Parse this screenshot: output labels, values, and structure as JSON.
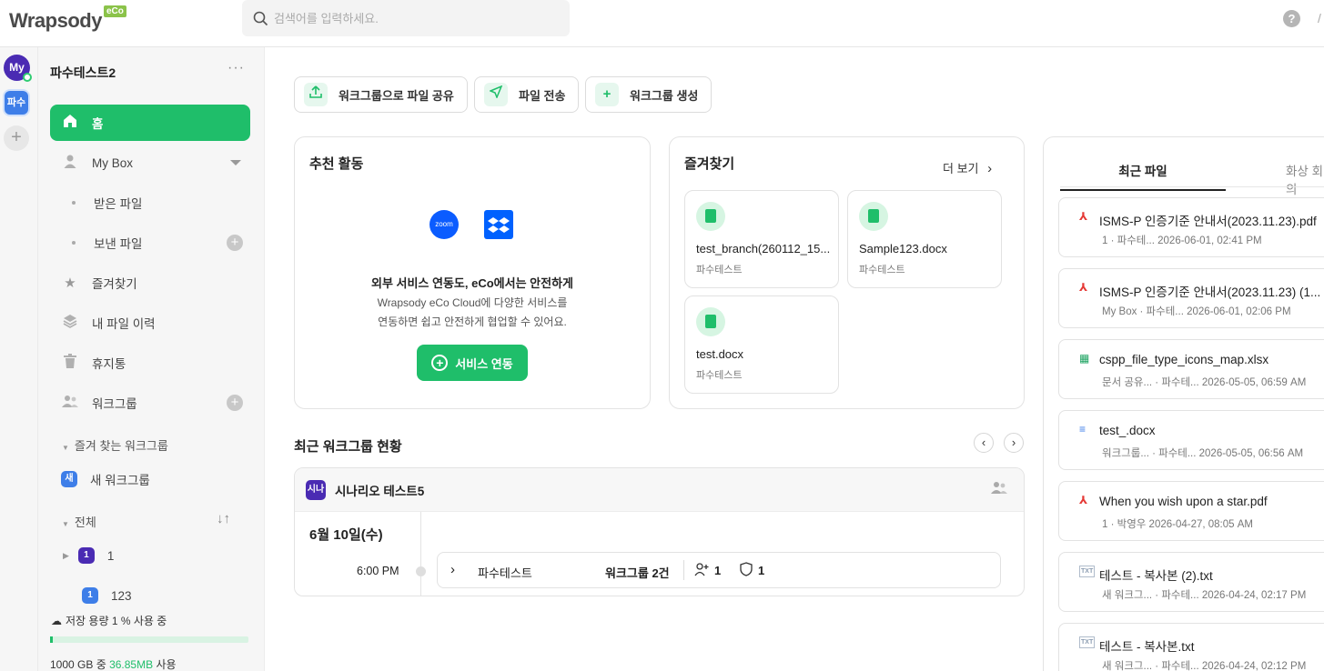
{
  "topbar": {
    "logo": "Wrapsody",
    "logo_badge": "eCo",
    "search_placeholder": "검색어를 입력하세요.",
    "help": "?",
    "user_glyph": "/"
  },
  "rail": {
    "avatar": "My",
    "workspace": "파수",
    "add": "+"
  },
  "sidebar": {
    "workspace_title": "파수테스트2",
    "more": "···",
    "items": [
      {
        "label": "홈",
        "icon": "home-icon"
      },
      {
        "label": "My Box",
        "icon": "user-icon"
      },
      {
        "label": "받은 파일"
      },
      {
        "label": "보낸 파일"
      },
      {
        "label": "즐겨찾기",
        "icon": "star-icon"
      },
      {
        "label": "내 파일 이력",
        "icon": "layers-icon"
      },
      {
        "label": "휴지통",
        "icon": "trash-icon"
      },
      {
        "label": "워크그룹",
        "icon": "group-icon"
      }
    ],
    "favorite_workgroups_label": "즐겨 찾는 워크그룹",
    "fav_workgroup": {
      "badge": "새",
      "label": "새 워크그룹"
    },
    "all_label": "전체",
    "workgroups": [
      {
        "badge": "1",
        "label": "1"
      },
      {
        "badge": "1",
        "label": "123"
      }
    ],
    "storage": {
      "label": "저장 용량 1 % 사용 중",
      "used_fraction": 0.01,
      "total": "1000 GB 중 ",
      "used": "36.85MB",
      "suffix": " 사용"
    }
  },
  "quick_actions": [
    {
      "label": "워크그룹으로 파일 공유",
      "icon": "upload-icon"
    },
    {
      "label": "파일 전송",
      "icon": "send-icon"
    },
    {
      "label": "워크그룹 생성",
      "icon": "plus-icon"
    }
  ],
  "recommend": {
    "title": "추천 활동",
    "zoom_label": "zoom",
    "headline": "외부 서비스 연동도, eCo에서는 안전하게",
    "desc_line1": "Wrapsody eCo Cloud에 다양한 서비스를",
    "desc_line2": "연동하면 쉽고 안전하게 협업할 수 있어요.",
    "button": "서비스 연동"
  },
  "favorites": {
    "title": "즐겨찾기",
    "more": "더 보기",
    "files": [
      {
        "name": "test_branch(260112_15...",
        "owner": "파수테스트"
      },
      {
        "name": "Sample123.docx",
        "owner": "파수테스트"
      },
      {
        "name": "test.docx",
        "owner": "파수테스트"
      }
    ]
  },
  "recent_workgroups": {
    "title": "최근 워크그룹 현황",
    "prev": "‹",
    "next": "›",
    "group": {
      "badge": "시나",
      "name": "시나리오 테스트5"
    },
    "date": "6월 10일(수)",
    "time": "6:00 PM",
    "row": {
      "actor": "파수테스트",
      "summary": "워크그룹 2건",
      "members": "1",
      "security": "1"
    }
  },
  "right_panel": {
    "tab_active": "최근 파일",
    "tab_inactive": "화상 회의",
    "files": [
      {
        "type": "pdf",
        "name": "ISMS-P 인증기준 안내서(2023.11.23).pdf",
        "meta": "1 · 파수테...    2026-06-01, 02:41 PM"
      },
      {
        "type": "pdf",
        "name": "ISMS-P 인증기준 안내서(2023.11.23) (1...",
        "meta": "My Box · 파수테...    2026-06-01, 02:06 PM"
      },
      {
        "type": "xlsx",
        "name": "cspp_file_type_icons_map.xlsx",
        "meta": "문서 공유... · 파수테...    2026-05-05, 06:59 AM"
      },
      {
        "type": "docx",
        "name": "test_.docx",
        "meta": "워크그룹... · 파수테...    2026-05-05, 06:56 AM"
      },
      {
        "type": "pdf",
        "name": "When you wish upon a star.pdf",
        "meta": "1 · 박영우    2026-04-27, 08:05 AM"
      },
      {
        "type": "txt",
        "name": "테스트 - 복사본 (2).txt",
        "meta": "새 워크그... · 파수테...    2026-04-24, 02:17 PM"
      },
      {
        "type": "txt",
        "name": "테스트 - 복사본.txt",
        "meta": "새 워크그... · 파수테...    2026-04-24, 02:12 PM"
      }
    ]
  },
  "colors": {
    "accent": "#1fbe6a",
    "workspace_purple": "#4a2bb3",
    "workspace_blue": "#3e7ee8"
  }
}
